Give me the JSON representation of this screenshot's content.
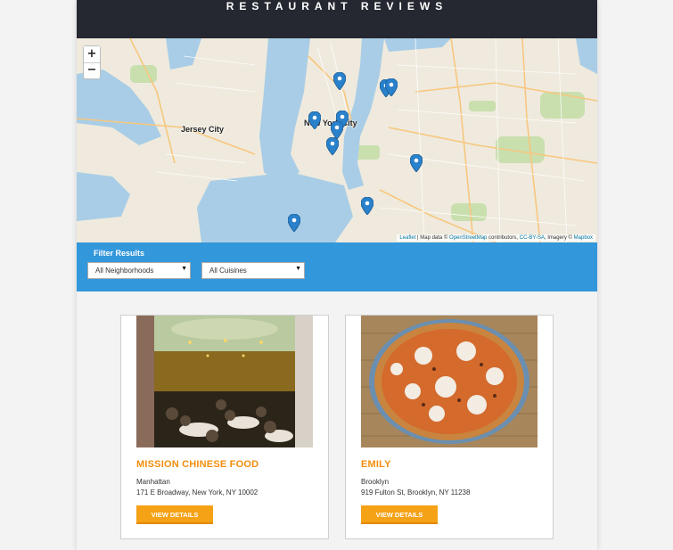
{
  "header": {
    "title": "RESTAURANT REVIEWS"
  },
  "map": {
    "zoom_in_label": "+",
    "zoom_out_label": "−",
    "labels": {
      "jersey_city": "Jersey City",
      "new_york_city": "New York City"
    },
    "attribution": {
      "leaflet": "Leaflet",
      "text1": " | Map data © ",
      "osm": "OpenStreetMap",
      "text2": " contributors, ",
      "license": "CC-BY-SA",
      "text3": ", Imagery © ",
      "mapbox": "Mapbox"
    },
    "marker_icon": "map-pin-icon",
    "marker_color": "#2a81cb"
  },
  "filter": {
    "label": "Filter Results",
    "neighborhood_select": "All Neighborhoods",
    "cuisine_select": "All Cuisines"
  },
  "restaurants": [
    {
      "name": "MISSION CHINESE FOOD",
      "neighborhood": "Manhattan",
      "address": "171 E Broadway, New York, NY 10002",
      "button": "VIEW DETAILS"
    },
    {
      "name": "EMILY",
      "neighborhood": "Brooklyn",
      "address": "919 Fulton St, Brooklyn, NY 11238",
      "button": "VIEW DETAILS"
    }
  ],
  "colors": {
    "header_bg": "#252831",
    "filter_bg": "#3397db",
    "accent": "#f28e0c",
    "button": "#f5a216"
  }
}
